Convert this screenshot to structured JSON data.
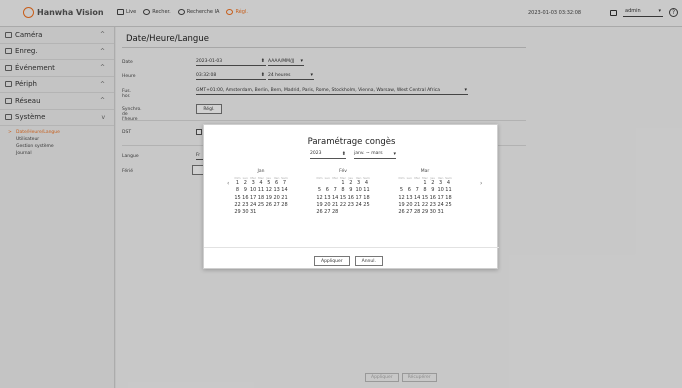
{
  "app": {
    "brand": "Hanwha Vision",
    "datetime": "2023-01-03 03:32:08",
    "user": "admin"
  },
  "topnav": [
    {
      "label": "Live",
      "icon": "monitor-icon"
    },
    {
      "label": "Recher.",
      "icon": "search-icon"
    },
    {
      "label": "Recherche IA",
      "icon": "ai-search-icon"
    },
    {
      "label": "Régl.",
      "icon": "settings-icon"
    }
  ],
  "sidebar": {
    "sections": [
      {
        "label": "Caméra",
        "icon": "camera-icon"
      },
      {
        "label": "Enreg.",
        "icon": "record-icon"
      },
      {
        "label": "Événement",
        "icon": "bell-icon"
      },
      {
        "label": "Périph",
        "icon": "device-icon"
      },
      {
        "label": "Réseau",
        "icon": "network-icon"
      },
      {
        "label": "Système",
        "icon": "gear-icon"
      }
    ],
    "system_items": [
      "Date/Heure/Langue",
      "Utilisateur",
      "Gestion système",
      "Journal"
    ]
  },
  "main": {
    "title": "Date/Heure/Langue",
    "labels": {
      "date": "Date",
      "heure": "Heure",
      "fus": "Fus. hor.",
      "synchro": "Synchro. de l'heure",
      "dst": "DST",
      "langue": "Langue",
      "ferie": "Férié"
    },
    "date_value": "2023-01-03",
    "date_format": "AAAA/MM/JJ",
    "time_value": "03:32:08",
    "time_format": "24 heures",
    "timezone": "GMT+01:00, Amsterdam, Berlin, Bern, Madrid, Paris, Rome, Stockholm, Vienna, Warsaw, West Central Africa",
    "sync_button": "Régl.",
    "langue_value": "Fr",
    "apply": "Appliquer",
    "cancel": "Récupérer"
  },
  "dialog": {
    "title": "Paramétrage congès",
    "year": "2023",
    "period": "janv. ~ mars",
    "weekdays": [
      "Dim",
      "Lun",
      "Mar",
      "Mer",
      "Jeu",
      "Ven",
      "Sam"
    ],
    "months": [
      {
        "name": "Jan",
        "weeks": [
          [
            "1",
            "2",
            "3",
            "4",
            "5",
            "6",
            "7"
          ],
          [
            "8",
            "9",
            "10",
            "11",
            "12",
            "13",
            "14"
          ],
          [
            "15",
            "16",
            "17",
            "18",
            "19",
            "20",
            "21"
          ],
          [
            "22",
            "23",
            "24",
            "25",
            "26",
            "27",
            "28"
          ],
          [
            "29",
            "30",
            "31",
            "",
            "",
            "",
            ""
          ]
        ]
      },
      {
        "name": "Fév",
        "weeks": [
          [
            "",
            "",
            "",
            "1",
            "2",
            "3",
            "4"
          ],
          [
            "5",
            "6",
            "7",
            "8",
            "9",
            "10",
            "11"
          ],
          [
            "12",
            "13",
            "14",
            "15",
            "16",
            "17",
            "18"
          ],
          [
            "19",
            "20",
            "21",
            "22",
            "23",
            "24",
            "25"
          ],
          [
            "26",
            "27",
            "28",
            "",
            "",
            "",
            ""
          ]
        ]
      },
      {
        "name": "Mar",
        "weeks": [
          [
            "",
            "",
            "",
            "1",
            "2",
            "3",
            "4"
          ],
          [
            "5",
            "6",
            "7",
            "8",
            "9",
            "10",
            "11"
          ],
          [
            "12",
            "13",
            "14",
            "15",
            "16",
            "17",
            "18"
          ],
          [
            "19",
            "20",
            "21",
            "22",
            "23",
            "24",
            "25"
          ],
          [
            "26",
            "27",
            "28",
            "29",
            "30",
            "31",
            ""
          ]
        ]
      }
    ],
    "apply": "Appliquer",
    "cancel": "Annul."
  }
}
